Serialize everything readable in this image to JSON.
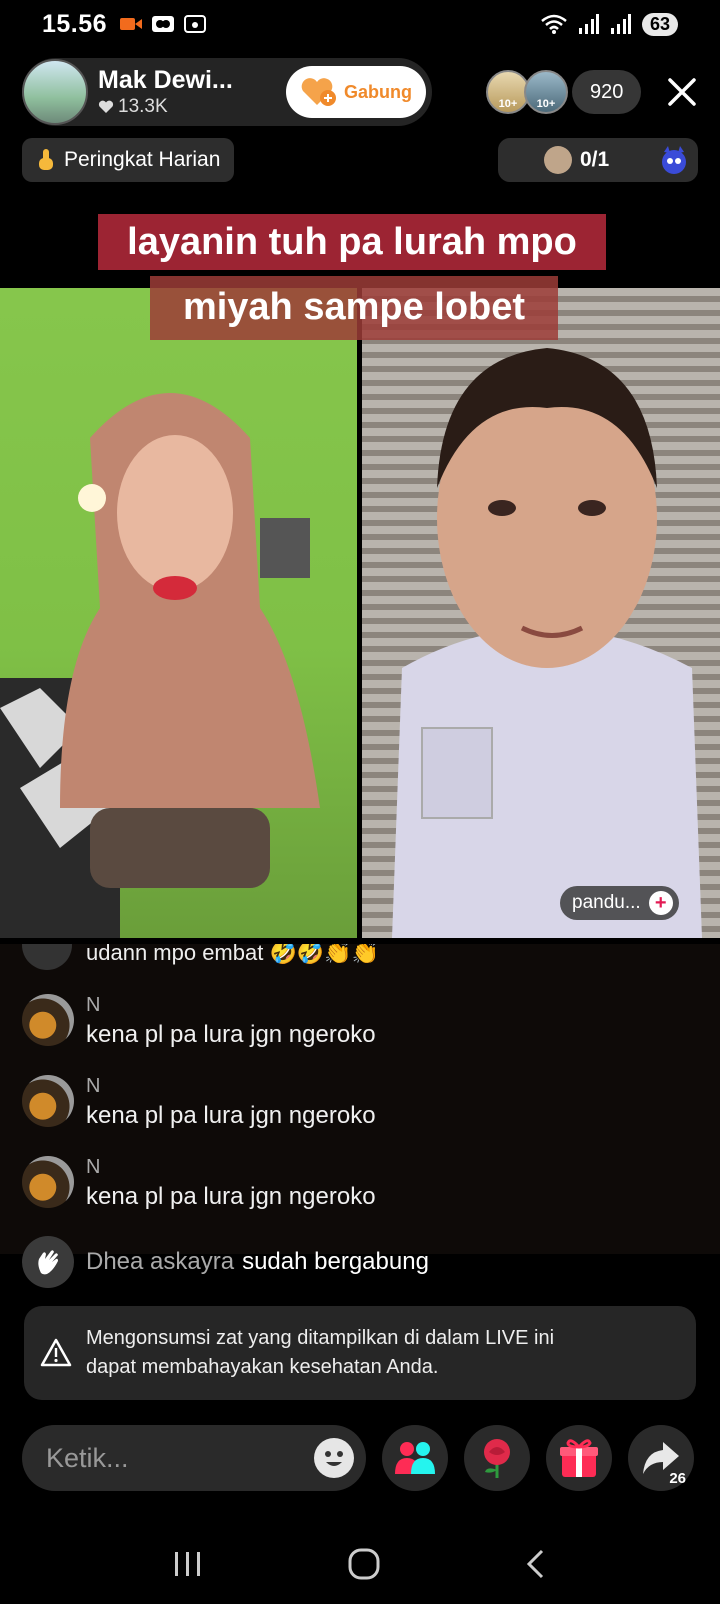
{
  "status_bar": {
    "time": "15.56",
    "battery": "63"
  },
  "host": {
    "name": "Mak Dewi...",
    "likes": "13.3K",
    "join_label": "Gabung"
  },
  "viewers": {
    "badge_1": "10+",
    "badge_2": "10+",
    "count": "920"
  },
  "ranking": {
    "label": "Peringkat Harian"
  },
  "cohost_slots": {
    "value": "0/1"
  },
  "caption": {
    "line1": "layanin tuh pa lurah mpo",
    "line2": "miyah sampe lobet"
  },
  "guest": {
    "name": "pandu..."
  },
  "comments": {
    "partial_text": "udann mpo embat 🤣🤣👏👏",
    "items": [
      {
        "user": "N",
        "text": "kena pl pa lura jgn ngeroko"
      },
      {
        "user": "N",
        "text": "kena pl pa lura jgn ngeroko"
      },
      {
        "user": "N",
        "text": "kena pl pa lura jgn ngeroko"
      }
    ],
    "join_user": "Dhea askayra",
    "join_text": "sudah bergabung"
  },
  "warning": {
    "line1": "Mengonsumsi zat yang ditampilkan di dalam LIVE ini",
    "line2": "dapat membahayakan kesehatan Anda."
  },
  "bottom_bar": {
    "input_placeholder": "Ketik...",
    "share_count": "26"
  },
  "colors": {
    "caption_bg": "#9c2433",
    "accent_pink": "#fe2c55",
    "join_orange": "#f08a2b"
  }
}
